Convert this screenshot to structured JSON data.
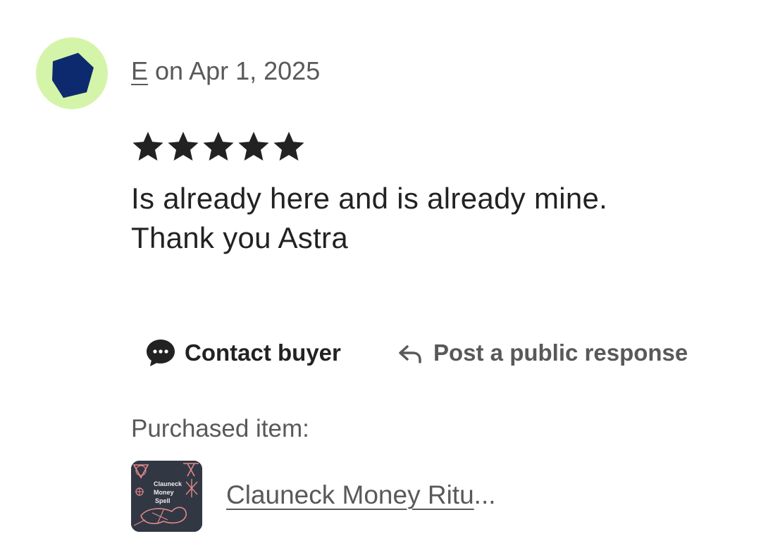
{
  "review": {
    "reviewer_initial": "E",
    "date_text": " on Apr 1, 2025",
    "rating": 5,
    "rating_max": 5,
    "text_line1": "Is already here and is already mine.",
    "text_line2": "Thank you Astra"
  },
  "actions": {
    "contact_label": "Contact buyer",
    "respond_label": "Post a public response"
  },
  "purchased": {
    "label": "Purchased item:",
    "item_title": "Clauneck Money Ritu",
    "ellipsis": "...",
    "thumb_text": [
      "Clauneck",
      "Money",
      "Spell"
    ]
  },
  "colors": {
    "avatar_bg": "#d4f5a9",
    "avatar_shape": "#0e2a6e",
    "text_primary": "#222222",
    "text_secondary": "#595959"
  },
  "icons": {
    "avatar": "pentagon-avatar-icon",
    "star": "star-icon",
    "contact": "chat-bubble-icon",
    "respond": "reply-arrow-icon"
  }
}
